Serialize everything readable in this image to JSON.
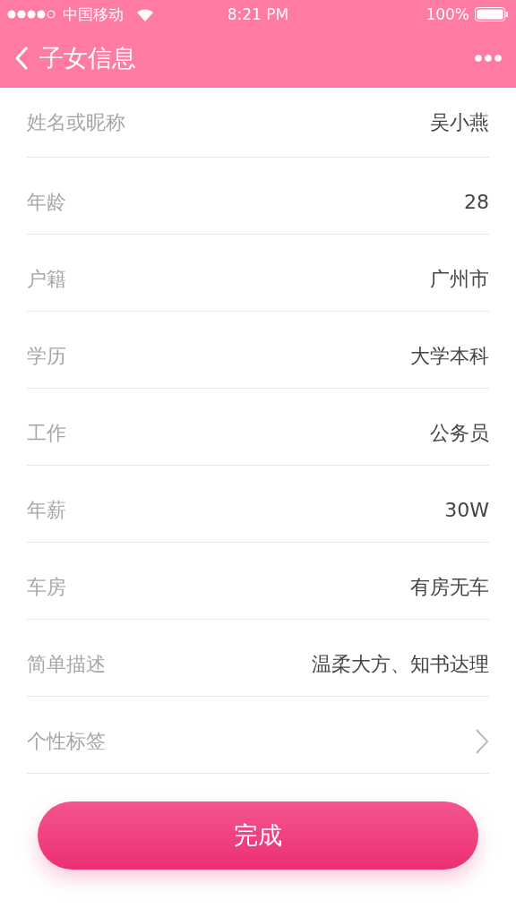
{
  "status_bar": {
    "carrier": "中国移动",
    "time": "8:21 PM",
    "battery": "100%"
  },
  "header": {
    "title": "子女信息"
  },
  "rows": [
    {
      "kind": "value",
      "label": "姓名或昵称",
      "value": "吴小燕"
    },
    {
      "kind": "value",
      "label": "年龄",
      "value": "28"
    },
    {
      "kind": "value",
      "label": "户籍",
      "value": "广州市"
    },
    {
      "kind": "value",
      "label": "学历",
      "value": "大学本科"
    },
    {
      "kind": "value",
      "label": "工作",
      "value": "公务员"
    },
    {
      "kind": "value",
      "label": "年薪",
      "value": "30W"
    },
    {
      "kind": "value",
      "label": "车房",
      "value": "有房无车"
    },
    {
      "kind": "value",
      "label": "简单描述",
      "value": "温柔大方、知书达理"
    },
    {
      "kind": "link",
      "label": "个性标签"
    }
  ],
  "button": {
    "label": "完成"
  }
}
